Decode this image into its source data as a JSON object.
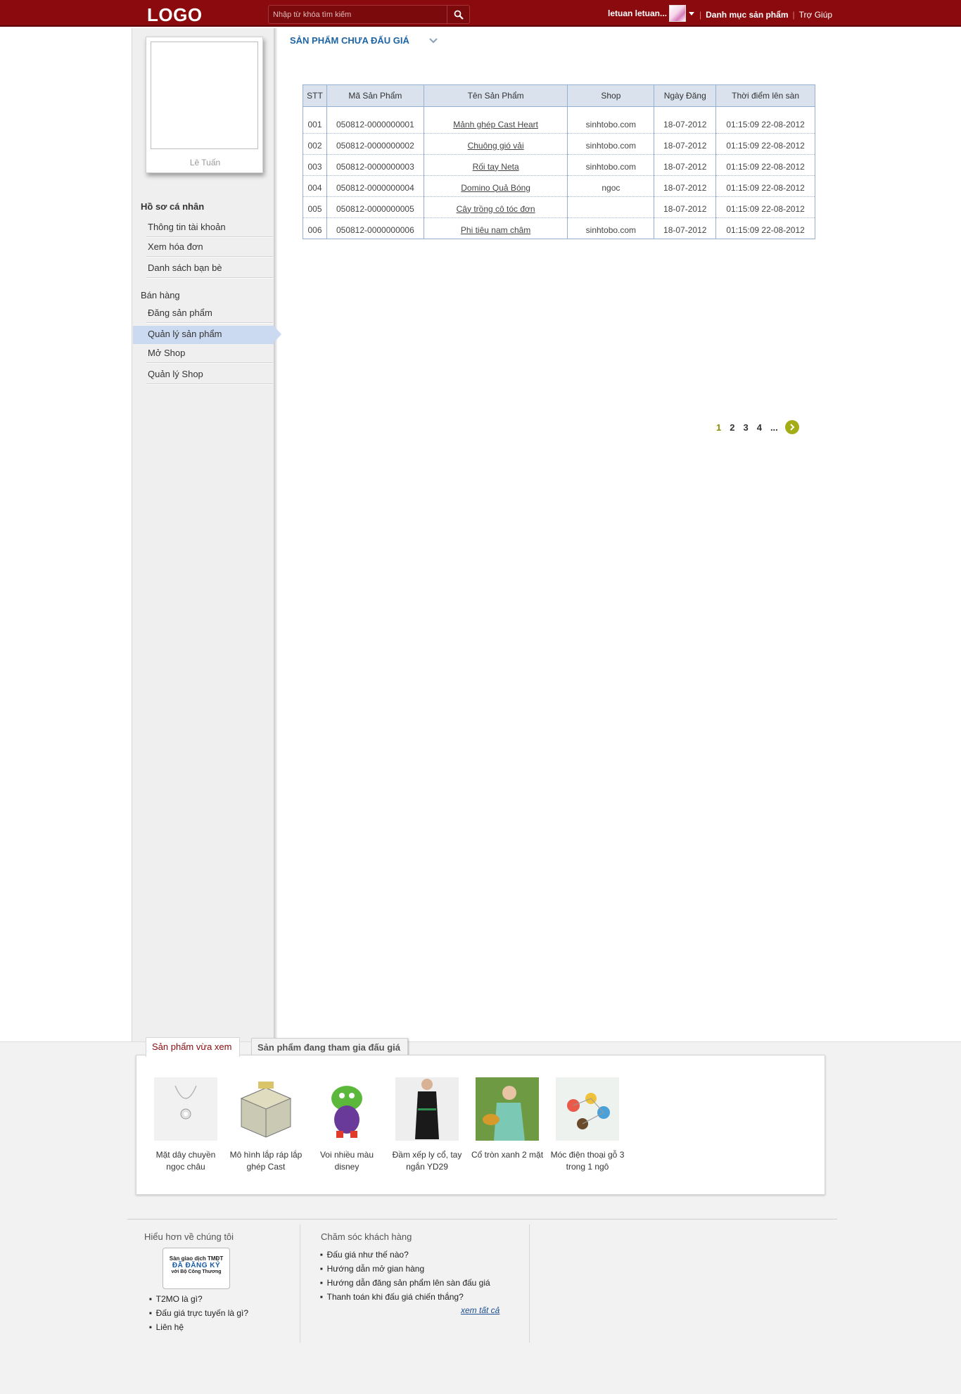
{
  "header": {
    "logo": "LOGO",
    "search_placeholder": "Nhập từ khóa tìm kiếm",
    "username": "letuan letuan...",
    "nav": [
      "Danh mục sản phẩm",
      "Trợ Giúp"
    ]
  },
  "profile": {
    "name": "Lê Tuấn"
  },
  "sidebar": {
    "section1_title": "Hồ sơ cá nhân",
    "section1_items": [
      "Thông tin tài khoản",
      "Xem hóa đơn",
      "Danh sách bạn bè"
    ],
    "section2_title": "Bán hàng",
    "section2_items": [
      "Đăng sản phẩm",
      "Quản lý sản phẩm",
      "Mở Shop",
      "Quản lý Shop"
    ],
    "active_item": "Quản lý sản phẩm"
  },
  "main": {
    "title": "SẢN PHẨM CHƯA ĐẤU GIÁ",
    "table": {
      "headers": [
        "STT",
        "Mã Sản Phẩm",
        "Tên Sản Phẩm",
        "Shop",
        "Ngày Đăng",
        "Thời điểm lên sàn"
      ],
      "rows": [
        [
          "001",
          "050812-0000000001",
          "Mảnh ghép Cast Heart",
          "sinhtobo.com",
          "18-07-2012",
          "01:15:09 22-08-2012"
        ],
        [
          "002",
          "050812-0000000002",
          "Chuông gió vải",
          "sinhtobo.com",
          "18-07-2012",
          "01:15:09 22-08-2012"
        ],
        [
          "003",
          "050812-0000000003",
          "Rối tay Neta",
          "sinhtobo.com",
          "18-07-2012",
          "01:15:09 22-08-2012"
        ],
        [
          "004",
          "050812-0000000004",
          "Domino Quả Bóng",
          "ngoc",
          "18-07-2012",
          "01:15:09 22-08-2012"
        ],
        [
          "005",
          "050812-0000000005",
          "Cây trồng cô tóc đơn",
          "",
          "18-07-2012",
          "01:15:09 22-08-2012"
        ],
        [
          "006",
          "050812-0000000006",
          "Phi tiêu nam châm",
          "sinhtobo.com",
          "18-07-2012",
          "01:15:09 22-08-2012"
        ]
      ]
    },
    "pagination": {
      "pages": [
        "1",
        "2",
        "3",
        "4",
        "..."
      ],
      "current": "1"
    }
  },
  "recent": {
    "tabs": [
      "Sản phẩm vừa xem",
      "Sản phẩm đang tham gia đấu giá"
    ],
    "products": [
      {
        "name": "Mặt dây chuyền ngọc châu",
        "icon": "necklace-thumbnail"
      },
      {
        "name": "Mô hình lắp ráp lắp ghép Cast",
        "icon": "puzzle-box-thumbnail"
      },
      {
        "name": "Voi nhiều màu disney",
        "icon": "elephant-toy-thumbnail"
      },
      {
        "name": "Đầm xếp ly cổ, tay ngắn YD29",
        "icon": "black-dress-thumbnail"
      },
      {
        "name": "Cổ tròn xanh 2 mặt",
        "icon": "green-top-thumbnail"
      },
      {
        "name": "Móc điện thoại gỗ 3 trong 1 ngô",
        "icon": "phone-charm-thumbnail"
      }
    ]
  },
  "footer": {
    "col1_title": "Hiểu hơn về chúng tôi",
    "badge": [
      "Sàn giao dịch TMĐT",
      "ĐÃ ĐĂNG KÝ",
      "với Bộ Công Thương"
    ],
    "col1_links": [
      "T2MO là gì?",
      "Đấu giá trực tuyến là gì?",
      "Liên hệ"
    ],
    "col2_title": "Chăm sóc khách hàng",
    "col2_links": [
      "Đấu giá như thế nào?",
      "Hướng dẫn mở gian hàng",
      "Hướng dẫn đăng sản phẩm lên sàn đấu giá",
      "Thanh toán khi đấu giá chiến thắng?"
    ],
    "see_all": "xem tất cả"
  },
  "colors": {
    "brand": "#8a0a0d",
    "accent_blue": "#1d64a4",
    "active_item": "#cbd9f1",
    "table_header": "#d9e2ed"
  }
}
